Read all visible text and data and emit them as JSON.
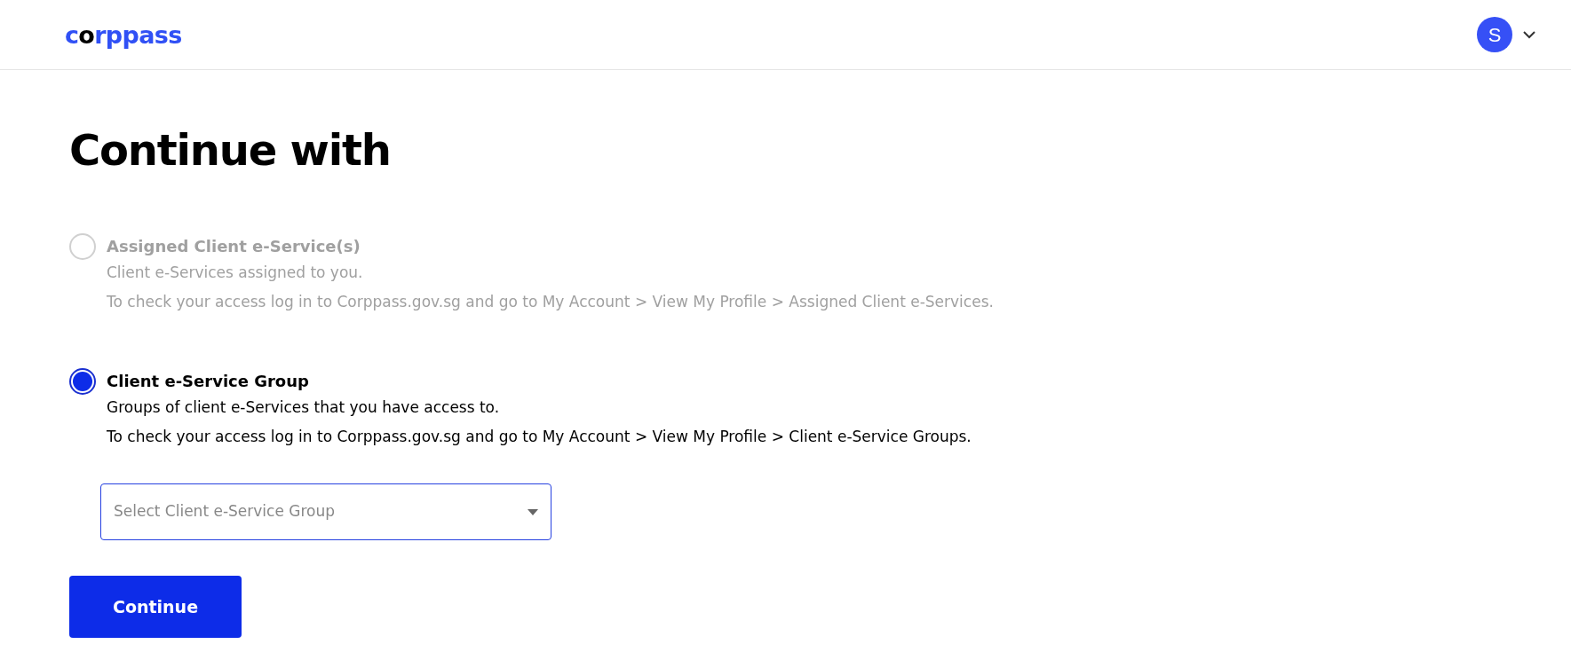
{
  "header": {
    "logo": "corppass",
    "avatar": "S"
  },
  "title": "Continue with",
  "options": [
    {
      "label": "Assigned Client e-Service(s)",
      "description": "Client e-Services assigned to you.",
      "hint": "To check your access log in to Corppass.gov.sg and go to My Account > View My Profile > Assigned Client e-Services.",
      "selected": false,
      "disabled": true
    },
    {
      "label": "Client e-Service Group",
      "description": "Groups of client e-Services that you have access to.",
      "hint": "To check your access log in to Corppass.gov.sg and go to My Account > View My Profile > Client e-Service Groups.",
      "selected": true,
      "disabled": false,
      "select": {
        "placeholder": "Select Client e-Service Group"
      }
    }
  ],
  "button": "Continue"
}
